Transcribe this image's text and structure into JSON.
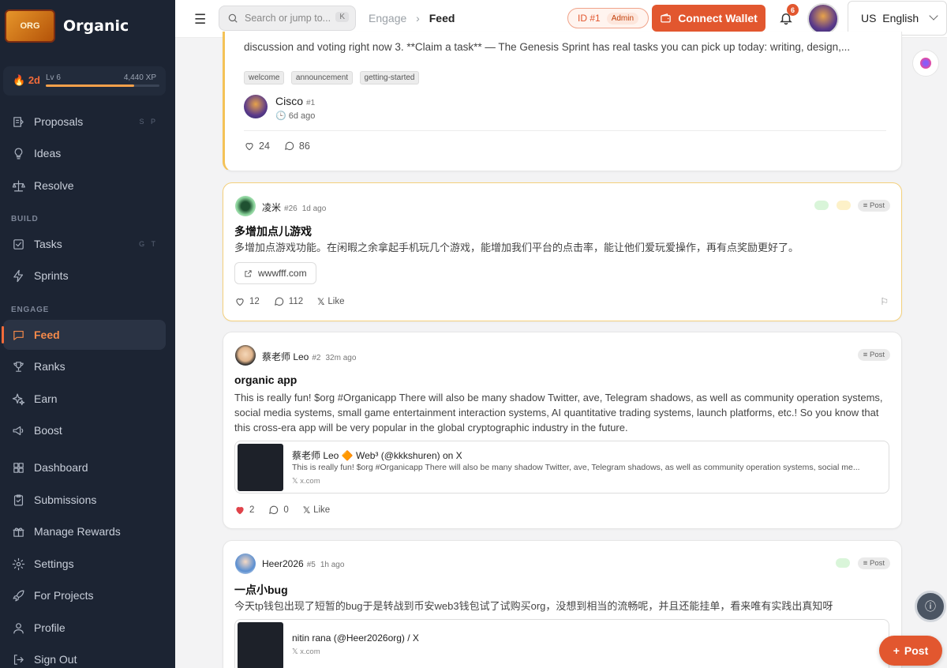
{
  "brand": {
    "name": "Organic",
    "logo_text": "ORGANIC\nINOTI"
  },
  "xp": {
    "streak": "2d",
    "level": "Lv 6",
    "xp_text": "4,440 XP",
    "progress": 0.78
  },
  "sidebar": {
    "sections": {
      "build": "BUILD",
      "engage": "ENGAGE"
    },
    "items": [
      {
        "label": "Proposals",
        "icon": "proposals-icon",
        "hint": "S P"
      },
      {
        "label": "Ideas",
        "icon": "lightbulb-icon",
        "hint": ""
      },
      {
        "label": "Resolve",
        "icon": "scale-icon",
        "hint": ""
      },
      {
        "label": "Tasks",
        "icon": "checkbox-icon",
        "hint": "G T"
      },
      {
        "label": "Sprints",
        "icon": "lightning-icon",
        "hint": ""
      },
      {
        "label": "Feed",
        "icon": "chat-icon",
        "hint": ""
      },
      {
        "label": "Ranks",
        "icon": "trophy-icon",
        "hint": ""
      },
      {
        "label": "Earn",
        "icon": "sparkle-icon",
        "hint": ""
      },
      {
        "label": "Boost",
        "icon": "megaphone-icon",
        "hint": ""
      },
      {
        "label": "Dashboard",
        "icon": "grid-icon",
        "hint": ""
      },
      {
        "label": "Submissions",
        "icon": "clipboard-icon",
        "hint": ""
      },
      {
        "label": "Manage Rewards",
        "icon": "gift-icon",
        "hint": ""
      },
      {
        "label": "Settings",
        "icon": "gear-icon",
        "hint": ""
      },
      {
        "label": "For Projects",
        "icon": "rocket-icon",
        "hint": ""
      },
      {
        "label": "Profile",
        "icon": "user-icon",
        "hint": ""
      },
      {
        "label": "Sign Out",
        "icon": "logout-icon",
        "hint": ""
      }
    ]
  },
  "topbar": {
    "search_placeholder": "Search or jump to...",
    "search_kbd": "K",
    "breadcrumb": {
      "parent": "Engage",
      "current": "Feed"
    },
    "id_pill": "ID #1",
    "admin_badge": "Admin",
    "wallet_label": "Connect Wallet",
    "notif_count": "6",
    "language": "US  English"
  },
  "feed": {
    "pinned": {
      "body_tail": "discussion and voting right now 3. **Claim a task** — The Genesis Sprint has real tasks you can pick up today: writing, design,...",
      "tags": [
        "welcome",
        "announcement",
        "getting-started"
      ],
      "author": "Cisco",
      "author_id": "#1",
      "time": "6d ago",
      "likes": "24",
      "comments": "86"
    },
    "posts": [
      {
        "author": "凌米",
        "author_id": "#26",
        "time": "1d ago",
        "badge": "Post",
        "title": "多增加点儿游戏",
        "body": "多增加点游戏功能。在闲暇之余拿起手机玩几个游戏，能增加我们平台的点击率，能让他们爱玩爱操作，再有点奖励更好了。",
        "link": "wwwfff.com",
        "likes": "12",
        "comments": "112",
        "share": "Like"
      },
      {
        "author": "蔡老师 Leo",
        "author_id": "#2",
        "time": "32m ago",
        "badge": "Post",
        "title": "organic app",
        "body": "This is really fun! $org #Organicapp There will also be many shadow Twitter, ave, Telegram shadows, as well as community operation systems, social media systems, small game entertainment interaction systems, AI quantitative trading systems, launch platforms, etc.! So you know that this cross-era app will be very popular in the global cryptographic industry in the future.",
        "embed_title": "蔡老师 Leo 🔶 Web³ (@kkkshuren) on X",
        "embed_desc": "This is really fun! $org #Organicapp There will also be many shadow Twitter, ave, Telegram shadows, as well as community operation systems, social me...",
        "embed_domain": "x.com",
        "likes": "2",
        "comments": "0",
        "share": "Like"
      },
      {
        "author": "Heer2026",
        "author_id": "#5",
        "time": "1h ago",
        "badge": "Post",
        "title": "一点小bug",
        "body": "今天tp钱包出现了短暂的bug于是转战到币安web3钱包试了试购买org，没想到相当的流畅呢，并且还能挂单，看来唯有实践出真知呀",
        "embed_title": "nitin rana (@Heer2026org) / X",
        "embed_domain": "x.com"
      }
    ]
  },
  "fab": {
    "post_label": "Post",
    "info_icon": "info-icon"
  },
  "colors": {
    "accent": "#e2572f",
    "sidebar_bg": "#1c2433",
    "active": "#f58a4a"
  }
}
